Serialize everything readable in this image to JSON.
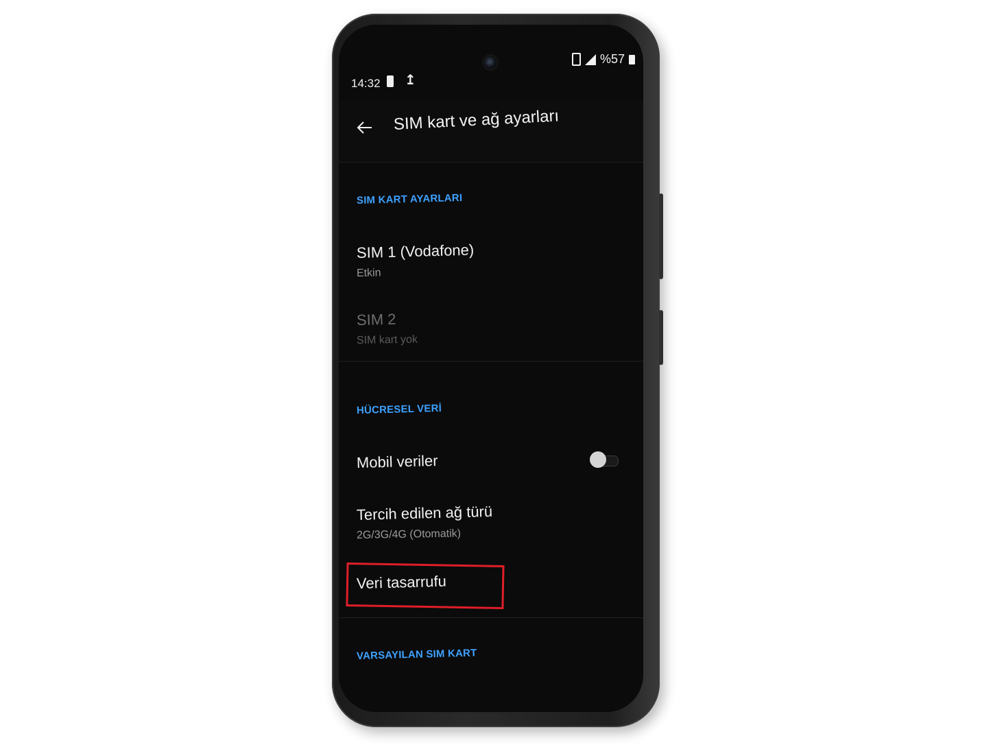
{
  "status_bar": {
    "time": "14:32",
    "battery_percent": "%57",
    "icons": [
      "battery-charging-icon",
      "upload-icon",
      "phone-icon",
      "signal-icon",
      "battery-icon"
    ]
  },
  "app_bar": {
    "title": "SIM kart ve ağ ayarları",
    "back_icon": "arrow-left-icon"
  },
  "sections": {
    "sim_settings": {
      "header": "SIM KART AYARLARI",
      "sim1": {
        "title": "SIM 1  (Vodafone)",
        "subtitle": "Etkin"
      },
      "sim2": {
        "title": "SIM 2",
        "subtitle": "SIM kart yok"
      }
    },
    "cellular_data": {
      "header": "HÜCRESEL VERİ",
      "mobile_data": {
        "title": "Mobil veriler",
        "toggle_on": false
      },
      "network_type": {
        "title": "Tercih edilen ağ türü",
        "subtitle": "2G/3G/4G (Otomatik)"
      },
      "data_saver": {
        "title": "Veri tasarrufu"
      }
    },
    "default_sim": {
      "header": "VARSAYILAN SIM KART"
    }
  },
  "colors": {
    "accent": "#3ea1ff",
    "background": "#0b0b0b",
    "highlight": "#e01e28"
  }
}
